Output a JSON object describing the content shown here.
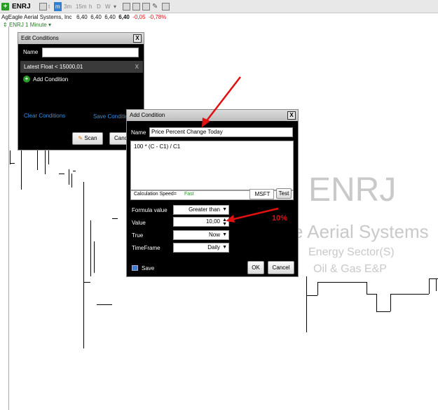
{
  "toolbar": {
    "symbol": "ENRJ",
    "tf_t": "t",
    "tf_1m": "m",
    "tf_3m": "3m",
    "tf_15m": "15m",
    "tf_h": "h",
    "tf_d": "D",
    "tf_w": "W"
  },
  "quote": {
    "company": "AgEagle Aerial Systems, Inc",
    "o": "6,40",
    "h": "6,40",
    "l": "6,40",
    "c": "6,40",
    "chg": "-0,05",
    "pct": "-0,78%"
  },
  "chart": {
    "label": "ENRJ 1 Minute"
  },
  "watermark": {
    "symbol": "ENRJ",
    "company": "e Aerial Systems",
    "sector": "Energy Sector(S)",
    "industry": "Oil & Gas E&P"
  },
  "edit_conditions": {
    "title": "Edit Conditions",
    "name_label": "Name",
    "name_value": "",
    "condition": "Latest Float < 15000,01",
    "condition_remove": "X",
    "add_condition": "Add Condition",
    "clear_conditions": "Clear Conditions",
    "save_conditions": "Save Conditio",
    "scan": "Scan",
    "cancel": "Canc"
  },
  "add_condition": {
    "title": "Add Condition",
    "name_label": "Name",
    "name_value": "Price Percent Change Today",
    "formula": "100 * (C - C1) / C1",
    "calc_speed_label": "Calculation Speed=",
    "calc_speed_value": "Fast",
    "test_symbol": "MSFT",
    "test_button": "Test",
    "formula_value_label": "Formula value",
    "formula_value": "Greater than",
    "value_label": "Value",
    "value": "10,00",
    "true_label": "True",
    "true_value": "Now",
    "timeframe_label": "TimeFrame",
    "timeframe_value": "Daily",
    "save": "Save",
    "ok": "OK",
    "cancel": "Cancel"
  },
  "annotation": {
    "text": "10%"
  },
  "colors": {
    "accent": "#2f7fd2",
    "negative": "#dd1111",
    "green": "#2a9a2a",
    "arrow": "#e01010"
  }
}
